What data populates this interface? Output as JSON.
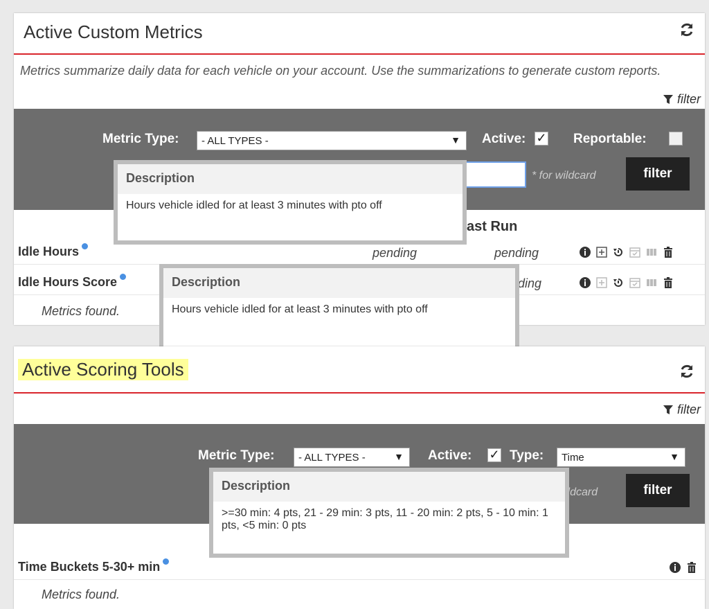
{
  "metrics_panel": {
    "title": "Active Custom Metrics",
    "description": "Metrics summarize daily data for each vehicle on your account. Use the summarizations to generate custom reports.",
    "filter_link": "filter",
    "filter_bar": {
      "metric_type_label": "Metric Type:",
      "metric_type_value": "- ALL TYPES -",
      "active_label": "Active:",
      "active_checked": "✓",
      "reportable_label": "Reportable:",
      "wildcard_hint": "* for wildcard",
      "filter_button": "filter"
    },
    "columns": {
      "last_run_fragment": "ast Run"
    },
    "rows": [
      {
        "name": "Idle Hours",
        "status1": "pending",
        "status2": "pending"
      },
      {
        "name": "Idle Hours Score",
        "status2_fragment": "ding"
      }
    ],
    "found_text": "Metrics found.",
    "tooltips": [
      {
        "heading": "Description",
        "body": "Hours vehicle idled for at least 3 minutes with pto off"
      },
      {
        "heading": "Description",
        "body": "Hours vehicle idled for at least 3 minutes with pto off"
      }
    ]
  },
  "scoring_panel": {
    "title": "Active Scoring Tools",
    "filter_link": "filter",
    "filter_bar": {
      "metric_type_label": "Metric Type:",
      "metric_type_value": "- ALL TYPES -",
      "active_label": "Active:",
      "active_checked": "✓",
      "type_label": "Type:",
      "type_value": "Time",
      "wildcard_fragment": "ildcard",
      "filter_button": "filter"
    },
    "rows": [
      {
        "name": "Time Buckets 5-30+ min"
      }
    ],
    "found_text": "Metrics found.",
    "tooltip": {
      "heading": "Description",
      "body": ">=30 min: 4 pts, 21 - 29 min: 3 pts, 11 - 20 min: 2 pts, 5 - 10 min: 1 pts, <5 min: 0 pts"
    }
  },
  "colors": {
    "header_rule": "#d9252c",
    "filter_bar_bg": "#6d6d6d",
    "filter_button_bg": "#222222",
    "title_highlight": "#ffff9a",
    "info_icon": "#4a90e2"
  }
}
